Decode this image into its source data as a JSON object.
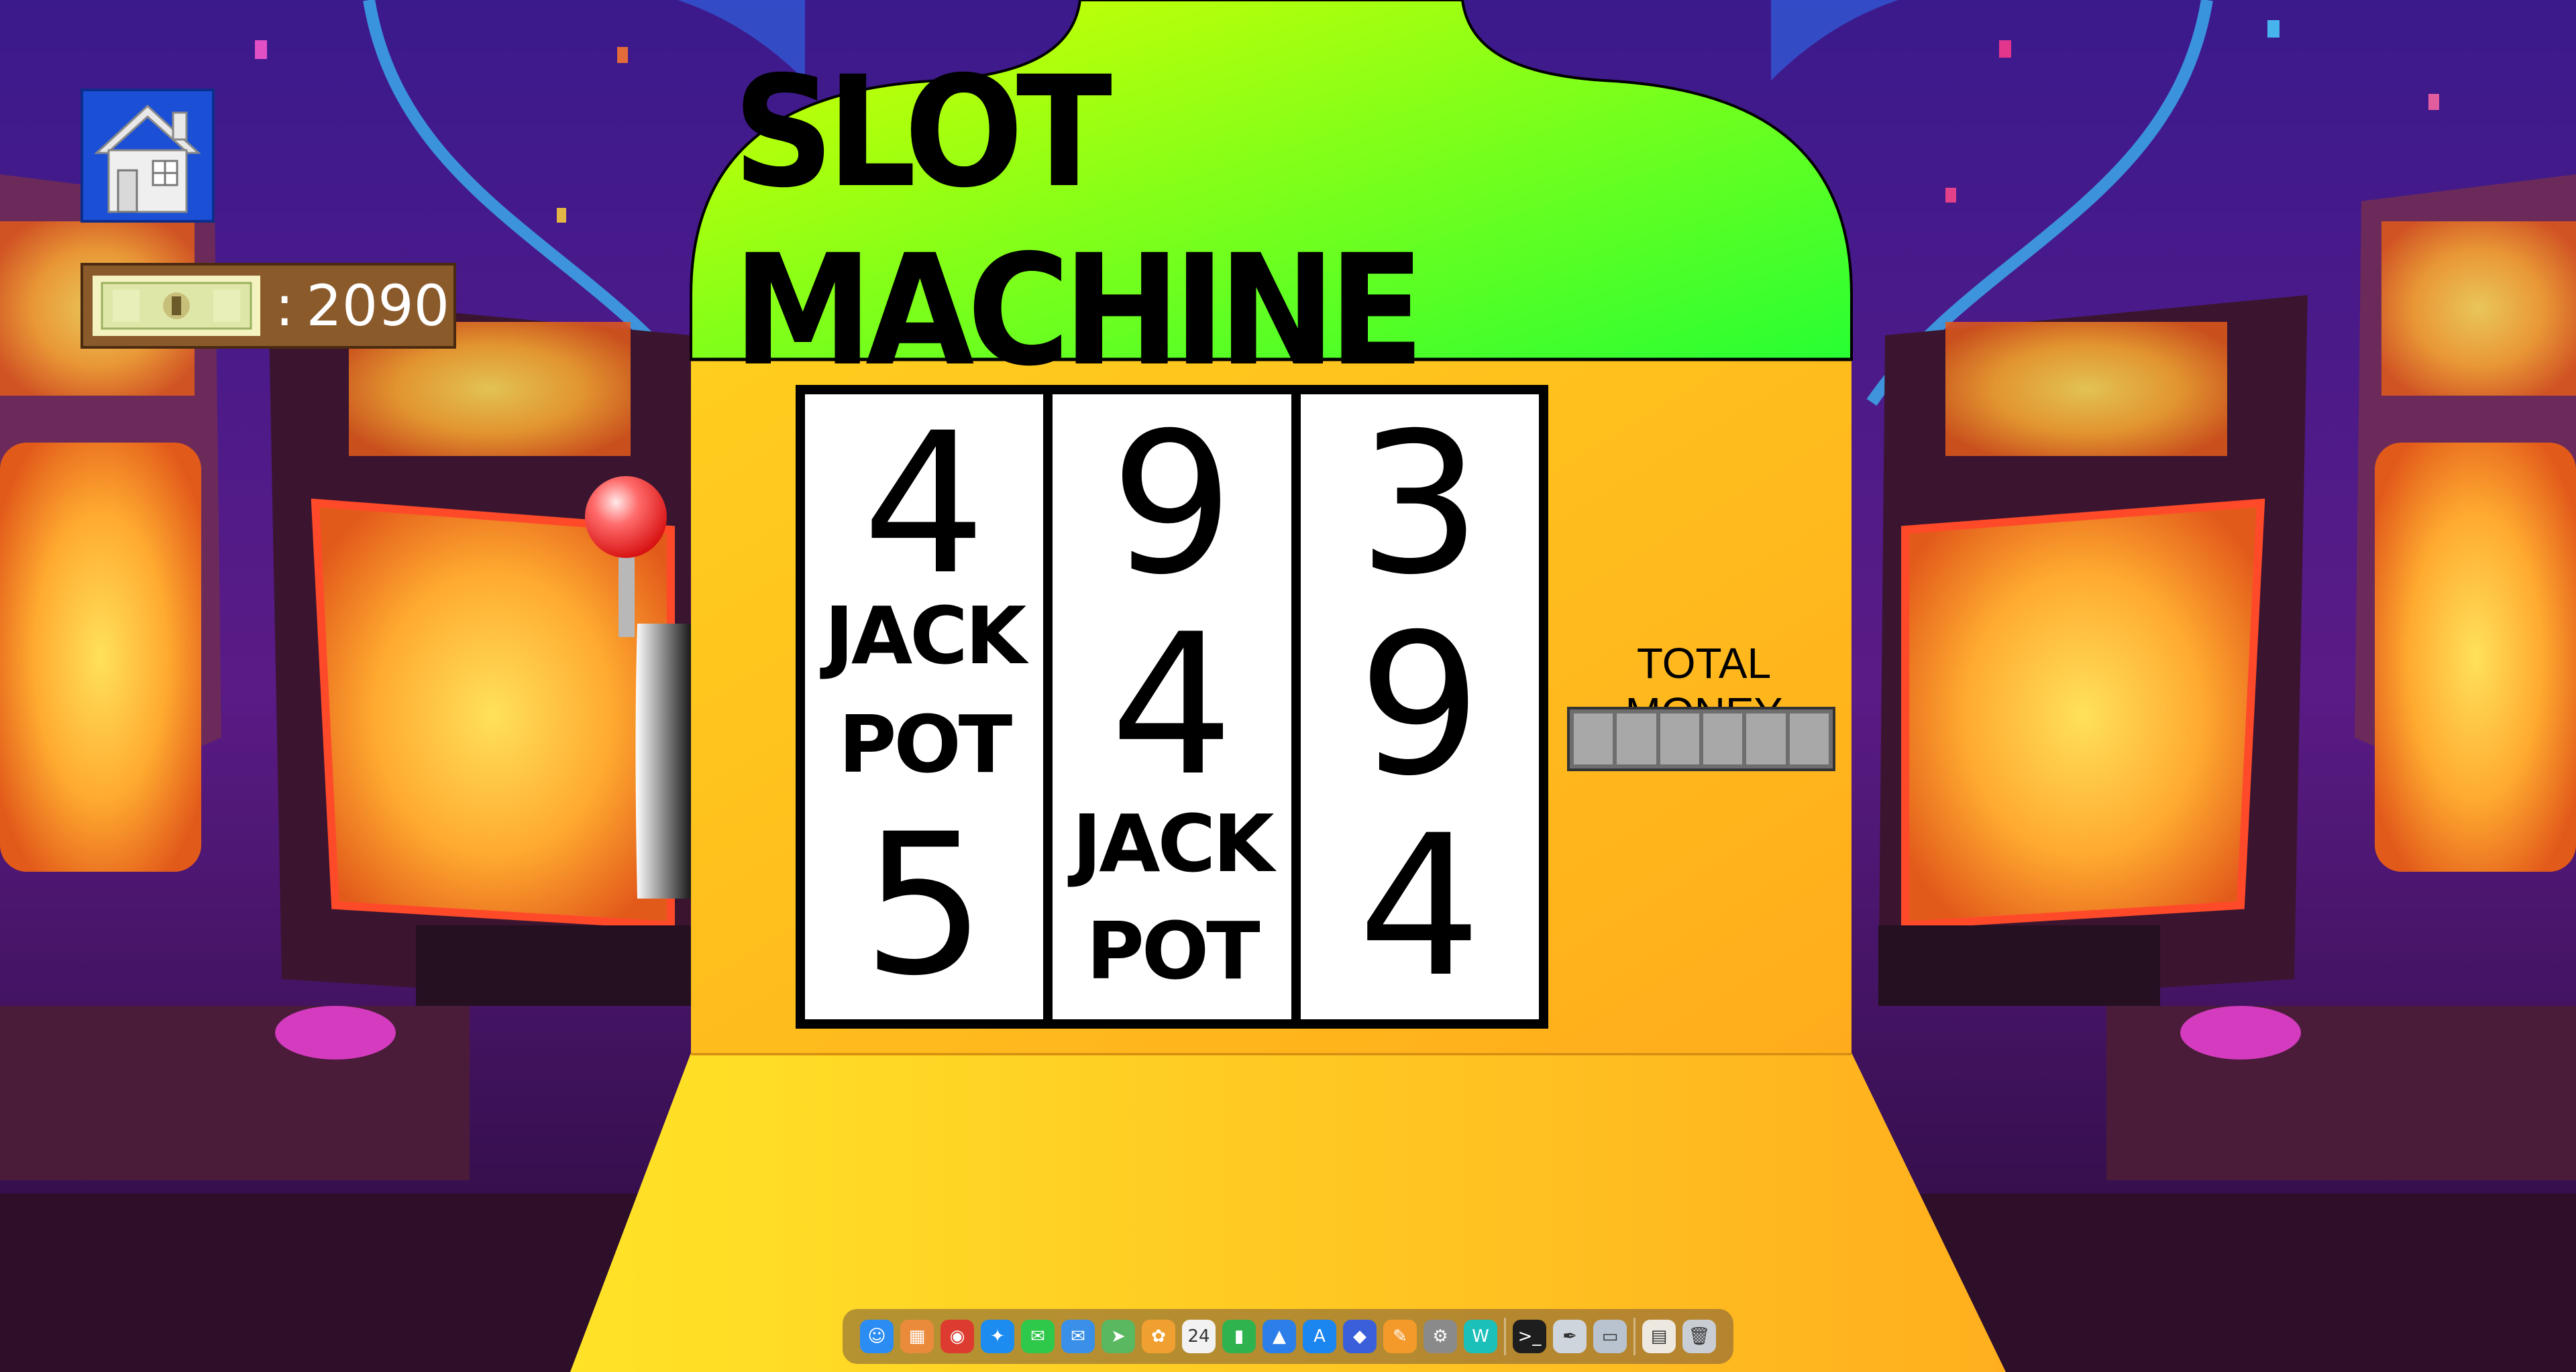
{
  "app": {
    "title": "SLOT MACHINE"
  },
  "header": {
    "home_icon": "home-icon"
  },
  "wallet": {
    "separator": ":",
    "amount": "2090",
    "icon": "money-bills-icon"
  },
  "reels": [
    {
      "symbols": [
        "4",
        "JACK",
        "POT",
        "5"
      ]
    },
    {
      "symbols": [
        "9",
        "4",
        "JACK",
        "POT"
      ]
    },
    {
      "symbols": [
        "3",
        "9",
        "4"
      ]
    }
  ],
  "total_money": {
    "label": "TOTAL MONEY",
    "slots": 6
  },
  "lever": {
    "icon": "lever-knob-icon"
  },
  "colors": {
    "header_top": "#c8ff00",
    "header_bottom": "#2dff2d",
    "cabinet": "#ffb81f",
    "lever_ball": "#e01c1c",
    "home_bg": "#1a4fd6"
  },
  "dock": {
    "items": [
      {
        "name": "finder-icon",
        "color": "#2b8cf3",
        "glyph": "☺"
      },
      {
        "name": "launchpad-icon",
        "color": "#e98b3a",
        "glyph": "▦"
      },
      {
        "name": "chrome-icon",
        "color": "#dd3b2f",
        "glyph": "◉"
      },
      {
        "name": "safari-icon",
        "color": "#1c8cf0",
        "glyph": "✦"
      },
      {
        "name": "messages-icon",
        "color": "#2ec84a",
        "glyph": "✉"
      },
      {
        "name": "mail-icon",
        "color": "#3a8fe8",
        "glyph": "✉"
      },
      {
        "name": "maps-icon",
        "color": "#59b860",
        "glyph": "➤"
      },
      {
        "name": "photos-icon",
        "color": "#f0a030",
        "glyph": "✿"
      },
      {
        "name": "calendar-icon",
        "color": "#f2f2f2",
        "glyph": "24"
      },
      {
        "name": "numbers-icon",
        "color": "#2fb34e",
        "glyph": "▮"
      },
      {
        "name": "keynote-icon",
        "color": "#2c7fe8",
        "glyph": "▲"
      },
      {
        "name": "app-store-icon",
        "color": "#1b85f0",
        "glyph": "A"
      },
      {
        "name": "vpn-icon",
        "color": "#3a5fd8",
        "glyph": "◆"
      },
      {
        "name": "pages-icon",
        "color": "#f39a2a",
        "glyph": "✎"
      },
      {
        "name": "settings-icon",
        "color": "#8a8a8a",
        "glyph": "⚙"
      },
      {
        "name": "webex-icon",
        "color": "#1bc0b8",
        "glyph": "W"
      },
      {
        "name": "terminal-icon",
        "color": "#1e1e1e",
        "glyph": ">_"
      },
      {
        "name": "text-tool-icon",
        "color": "#cfd5dc",
        "glyph": "✒"
      },
      {
        "name": "display-icon",
        "color": "#b9c3cf",
        "glyph": "▭"
      },
      {
        "name": "document-icon",
        "color": "#ede9e0",
        "glyph": "▤"
      },
      {
        "name": "trash-icon",
        "color": "#c9ced4",
        "glyph": "🗑"
      }
    ]
  }
}
